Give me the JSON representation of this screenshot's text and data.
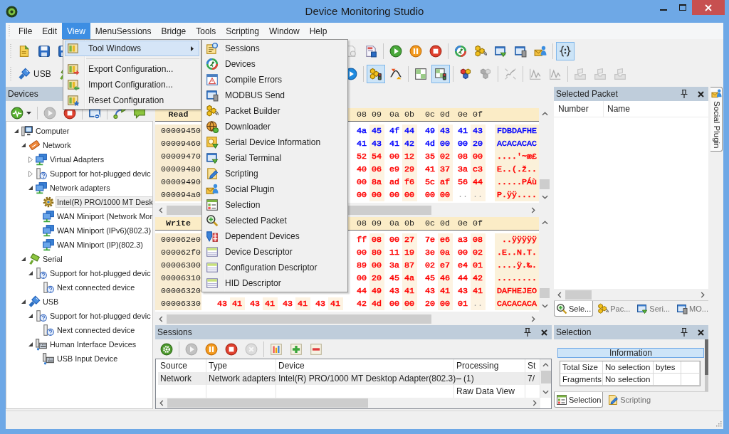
{
  "window": {
    "title": "Device Monitoring Studio"
  },
  "menu_bar": [
    {
      "label": "File",
      "selected": false
    },
    {
      "label": "Edit",
      "selected": false
    },
    {
      "label": "View",
      "selected": true
    },
    {
      "label": "MenuSessions",
      "selected": false
    },
    {
      "label": "Bridge",
      "selected": false
    },
    {
      "label": "Tools",
      "selected": false
    },
    {
      "label": "Scripting",
      "selected": false
    },
    {
      "label": "Window",
      "selected": false
    },
    {
      "label": "Help",
      "selected": false
    }
  ],
  "view_menu": [
    {
      "kind": "tool_windows",
      "label": "Tool Windows",
      "selected": true,
      "submenu": true
    },
    {
      "kind": "separator"
    },
    {
      "kind": "export",
      "label": "Export Configuration...",
      "selected": false,
      "submenu": false
    },
    {
      "kind": "import",
      "label": "Import Configuration...",
      "selected": false,
      "submenu": false
    },
    {
      "kind": "reset",
      "label": "Reset Configuration",
      "selected": false,
      "submenu": false
    }
  ],
  "tool_windows_menu": [
    {
      "kind": "sessions",
      "label": "Sessions"
    },
    {
      "kind": "devices",
      "label": "Devices"
    },
    {
      "kind": "errors",
      "label": "Compile Errors"
    },
    {
      "kind": "modbus",
      "label": "MODBUS Send"
    },
    {
      "kind": "builder",
      "label": "Packet Builder"
    },
    {
      "kind": "downloader",
      "label": "Downloader"
    },
    {
      "kind": "serial_info",
      "label": "Serial Device Information"
    },
    {
      "kind": "terminal",
      "label": "Serial Terminal"
    },
    {
      "kind": "scripting",
      "label": "Scripting"
    },
    {
      "kind": "social",
      "label": "Social Plugin"
    },
    {
      "kind": "selection",
      "label": "Selection"
    },
    {
      "kind": "selected_packet",
      "label": "Selected Packet"
    },
    {
      "kind": "dependent",
      "label": "Dependent Devices"
    },
    {
      "kind": "descriptor",
      "label": "Device Descriptor"
    },
    {
      "kind": "descriptor",
      "label": "Configuration Descriptor"
    },
    {
      "kind": "descriptor",
      "label": "HID Descriptor"
    }
  ],
  "toolbars": [
    {
      "start": [
        {
          "kind": "new",
          "pressed": false,
          "disabled": false
        },
        {
          "kind": "save",
          "pressed": false,
          "disabled": false
        },
        {
          "kind": "save_as",
          "pressed": false,
          "disabled": false
        }
      ],
      "end": [
        {
          "kind": "preview",
          "pressed": false,
          "disabled": true
        },
        {
          "kind": "report",
          "pressed": false,
          "disabled": false
        },
        {
          "kind": "separator"
        },
        {
          "kind": "start",
          "pressed": false,
          "disabled": false
        },
        {
          "kind": "pause",
          "pressed": false,
          "disabled": false
        },
        {
          "kind": "stop",
          "pressed": false,
          "disabled": false
        },
        {
          "kind": "separator"
        },
        {
          "kind": "devices",
          "pressed": false,
          "disabled": false
        },
        {
          "kind": "builder",
          "pressed": false,
          "disabled": false
        },
        {
          "kind": "terminal",
          "pressed": false,
          "disabled": false
        },
        {
          "kind": "modbus",
          "pressed": false,
          "disabled": false
        },
        {
          "kind": "social",
          "pressed": false,
          "disabled": false
        },
        {
          "kind": "separator"
        },
        {
          "kind": "script_editor",
          "pressed": true,
          "disabled": false
        }
      ]
    },
    {
      "start": [
        {
          "kind": "usb",
          "label": "USB",
          "pressed": false,
          "disabled": false
        },
        {
          "kind": "serial",
          "pressed": false,
          "disabled": false
        }
      ],
      "end": [
        {
          "kind": "resume",
          "pressed": false,
          "disabled": false
        },
        {
          "kind": "separator"
        },
        {
          "kind": "filter",
          "pressed": true,
          "disabled": false
        },
        {
          "kind": "wave",
          "pressed": false,
          "disabled": false
        },
        {
          "kind": "separator"
        },
        {
          "kind": "grid",
          "pressed": false,
          "disabled": false
        },
        {
          "kind": "grid_light",
          "pressed": true,
          "disabled": false
        },
        {
          "kind": "separator"
        },
        {
          "kind": "hexagons",
          "pressed": false,
          "disabled": false
        },
        {
          "kind": "hexagons",
          "pressed": false,
          "disabled": true
        },
        {
          "kind": "separator"
        },
        {
          "kind": "diagram",
          "pressed": false,
          "disabled": true
        },
        {
          "kind": "separator"
        },
        {
          "kind": "chart",
          "pressed": false,
          "disabled": true
        },
        {
          "kind": "chart",
          "pressed": false,
          "disabled": true
        },
        {
          "kind": "separator"
        },
        {
          "kind": "tray",
          "pressed": false,
          "disabled": true
        },
        {
          "kind": "tray",
          "pressed": false,
          "disabled": true
        },
        {
          "kind": "tray",
          "pressed": false,
          "disabled": true
        }
      ]
    }
  ],
  "devices_panel": {
    "title": "Devices",
    "toolbar": [
      {
        "kind": "monitor",
        "dropdown": true,
        "disabled": false
      },
      {
        "kind": "separator"
      },
      {
        "kind": "start",
        "dropdown": false,
        "disabled": true
      },
      {
        "kind": "stop",
        "dropdown": false,
        "disabled": false
      },
      {
        "kind": "separator"
      },
      {
        "kind": "window",
        "dropdown": false,
        "disabled": false
      },
      {
        "kind": "separator"
      },
      {
        "kind": "link",
        "dropdown": false,
        "disabled": false
      },
      {
        "kind": "bubble",
        "dropdown": false,
        "disabled": false
      }
    ],
    "tree": [
      {
        "kind": "computer",
        "label": "Computer",
        "expanded": true,
        "selected": false,
        "children": [
          {
            "kind": "network",
            "label": "Network",
            "expanded": true,
            "selected": false,
            "children": [
              {
                "kind": "adapters",
                "label": "Virtual Adapters",
                "expanded": false,
                "selected": false
              },
              {
                "kind": "hotplug",
                "label": "Support for hot-plugged devic",
                "expanded": false,
                "selected": false
              },
              {
                "kind": "adapters",
                "label": "Network adapters",
                "expanded": true,
                "selected": false,
                "children": [
                  {
                    "kind": "nic",
                    "label": "Intel(R) PRO/1000 MT Desk",
                    "selected": true
                  },
                  {
                    "kind": "adapter",
                    "label": "WAN Miniport (Network Mor",
                    "selected": false
                  },
                  {
                    "kind": "adapter",
                    "label": "WAN Miniport (IPv6)(802.3)",
                    "selected": false
                  },
                  {
                    "kind": "adapter",
                    "label": "WAN Miniport (IP)(802.3)",
                    "selected": false
                  }
                ]
              }
            ]
          },
          {
            "kind": "serial",
            "label": "Serial",
            "expanded": true,
            "selected": false,
            "children": [
              {
                "kind": "hotplug",
                "label": "Support for hot-plugged devic",
                "expanded": true,
                "selected": false,
                "children": [
                  {
                    "kind": "hotplug",
                    "label": "Next connected device",
                    "selected": false
                  }
                ]
              }
            ]
          },
          {
            "kind": "usb",
            "label": "USB",
            "expanded": true,
            "selected": false,
            "children": [
              {
                "kind": "hotplug",
                "label": "Support for hot-plugged devic",
                "expanded": true,
                "selected": false,
                "children": [
                  {
                    "kind": "hotplug",
                    "label": "Next connected device",
                    "selected": false
                  }
                ]
              },
              {
                "kind": "hid",
                "label": "Human Interface Devices",
                "expanded": true,
                "selected": false,
                "children": [
                  {
                    "kind": "hid",
                    "label": "USB Input Device",
                    "selected": false
                  }
                ]
              }
            ]
          }
        ]
      }
    ]
  },
  "hex_views": [
    {
      "title": "Read",
      "columns": [
        "08",
        "09",
        "0a",
        "0b",
        "0c",
        "0d",
        "0e",
        "0f"
      ],
      "rows": [
        {
          "address": "00009450",
          "high": [
            "4a",
            "45",
            "4f",
            "44",
            "49",
            "43",
            "41",
            "43"
          ],
          "ascii": "FDBDAFHE",
          "color": "#0000ff"
        },
        {
          "address": "00009460",
          "high": [
            "41",
            "43",
            "41",
            "42",
            "4d",
            "00",
            "00",
            "20"
          ],
          "ascii": "ACACACAC",
          "color": "#0000ff"
        },
        {
          "address": "00009470",
          "high": [
            "52",
            "54",
            "00",
            "12",
            "35",
            "02",
            "08",
            "00"
          ],
          "ascii": "....'~æ£",
          "color": "#ff0000"
        },
        {
          "address": "00009480",
          "high": [
            "40",
            "06",
            "e9",
            "29",
            "41",
            "37",
            "3a",
            "c3"
          ],
          "ascii": "E..(.ž..",
          "color": "#ff0000"
        },
        {
          "address": "00009490",
          "high": [
            "00",
            "8a",
            "ad",
            "f6",
            "5c",
            "af",
            "56",
            "44"
          ],
          "ascii": ".....PÁù",
          "color": "#ff0000"
        },
        {
          "address": "000094a0",
          "high": [
            "00",
            "00",
            "00",
            "00",
            "00",
            "00"
          ],
          "empty_cells": [
            "..",
            ".."
          ],
          "ascii": "P.ÿÿ....",
          "color": "#ff0000"
        }
      ]
    },
    {
      "title": "Write",
      "columns": [
        "08",
        "09",
        "0a",
        "0b",
        "0c",
        "0d",
        "0e",
        "0f"
      ],
      "rows": [
        {
          "address": "000062e0",
          "high": [
            "ff",
            "08",
            "00",
            "27",
            "7e",
            "e6",
            "a3",
            "08"
          ],
          "ascii": " ..ÿÿÿÿÿ",
          "color": "#ff0000"
        },
        {
          "address": "000062f0",
          "high": [
            "00",
            "80",
            "11",
            "19",
            "3e",
            "0a",
            "00",
            "02"
          ],
          "ascii": ".E..N.T.",
          "color": "#ff0000"
        },
        {
          "address": "00006300",
          "high": [
            "89",
            "00",
            "3a",
            "87",
            "02",
            "e7",
            "e4",
            "01"
          ],
          "ascii": "....ÿ.‰.",
          "color": "#ff0000"
        },
        {
          "address": "00006310",
          "high": [
            "00",
            "20",
            "45",
            "4a",
            "45",
            "46",
            "44",
            "42"
          ],
          "ascii": "........",
          "color": "#ff0000"
        },
        {
          "address": "00006320",
          "high": [
            "44",
            "49",
            "43",
            "41",
            "43",
            "41",
            "43",
            "41"
          ],
          "ascii": "DAFHEJEO",
          "color": "#ff0000"
        },
        {
          "address": "00006330",
          "low": [
            "43",
            "41",
            "43",
            "41",
            "43",
            "41",
            "43",
            "41"
          ],
          "high": [
            "42",
            "4d",
            "00",
            "00",
            "20",
            "00",
            "01"
          ],
          "empty_cells": [
            ".."
          ],
          "ascii": "CACACACA",
          "color": "#ff0000"
        }
      ]
    }
  ],
  "sessions_panel": {
    "title": "Sessions",
    "toolbar": [
      {
        "kind": "settings",
        "disabled": false
      },
      {
        "kind": "separator"
      },
      {
        "kind": "start",
        "disabled": true
      },
      {
        "kind": "pause",
        "disabled": false
      },
      {
        "kind": "stop",
        "disabled": false
      },
      {
        "kind": "cancel",
        "disabled": true
      },
      {
        "kind": "separator"
      },
      {
        "kind": "bars",
        "disabled": false
      },
      {
        "kind": "add",
        "disabled": false
      },
      {
        "kind": "remove",
        "disabled": false
      }
    ],
    "table": {
      "columns": [
        "Source",
        "Type",
        "Device",
        "Processing",
        "St"
      ],
      "rows": [
        {
          "cells": [
            "Network",
            "Network adapters",
            "Intel(R) PRO/1000 MT Desktop Adapter(802.3)",
            "(1)",
            "7/"
          ],
          "selected": true,
          "expanded": true,
          "children": [
            {
              "label": "Raw Data View"
            }
          ]
        }
      ]
    }
  },
  "selected_packet_panel": {
    "title": "Selected Packet",
    "columns": [
      "Number",
      "Name"
    ],
    "tabs": [
      {
        "kind": "selected_packet",
        "label": "Sele...",
        "selected": true
      },
      {
        "kind": "builder",
        "label": "Pac...",
        "selected": false
      },
      {
        "kind": "terminal",
        "label": "Seri...",
        "selected": false
      },
      {
        "kind": "modbus",
        "label": "MO...",
        "selected": false
      }
    ]
  },
  "selection_panel": {
    "title": "Selection",
    "section": "Information",
    "rows": [
      [
        "Total Size",
        "No selection",
        "bytes"
      ],
      [
        "Fragments",
        "No selection"
      ]
    ],
    "tabs": [
      {
        "kind": "selection",
        "label": "Selection",
        "selected": true
      },
      {
        "kind": "scripting",
        "label": "Scripting",
        "selected": false
      }
    ]
  },
  "side_tabs": [
    {
      "kind": "social",
      "label": "Social Plugin"
    }
  ]
}
